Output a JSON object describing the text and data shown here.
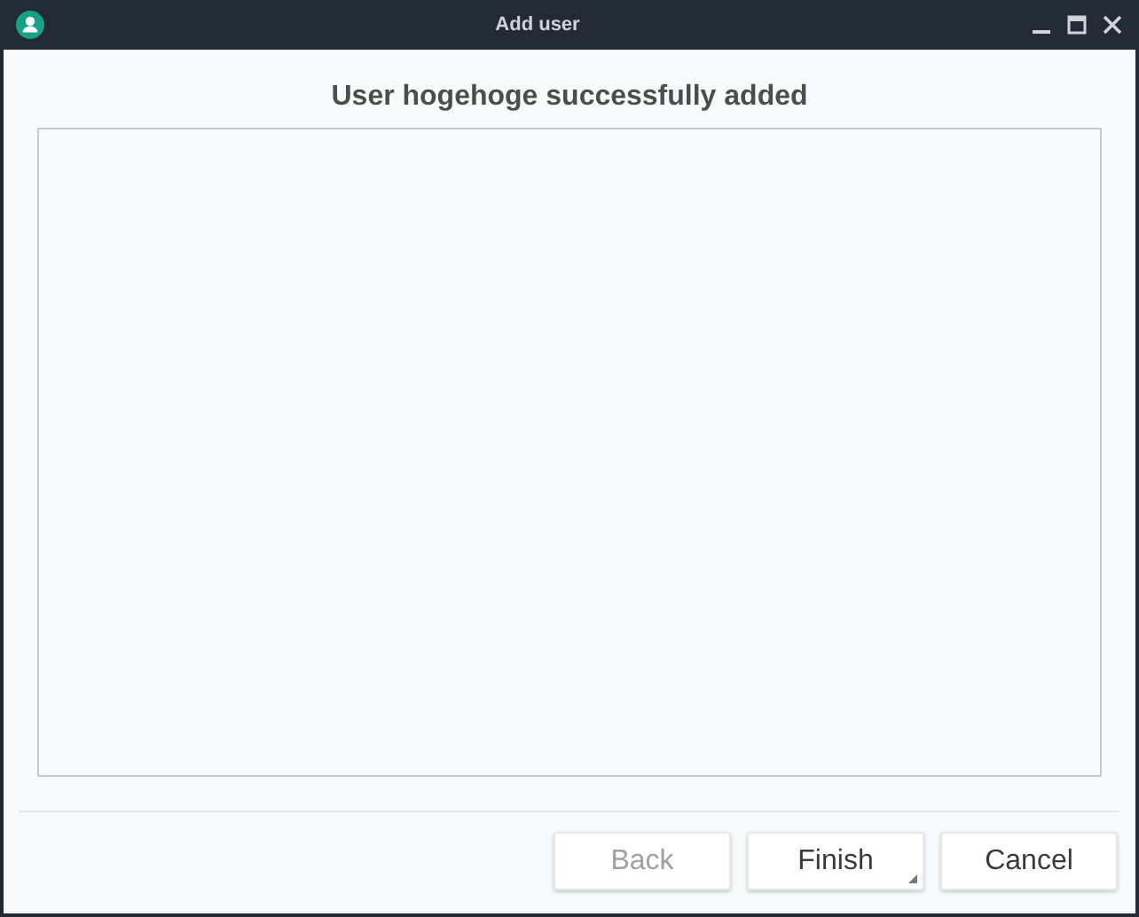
{
  "window": {
    "title": "Add user"
  },
  "heading": "User hogehoge successfully added",
  "buttons": [
    {
      "label": "Back",
      "disabled": true,
      "default": false
    },
    {
      "label": "Finish",
      "disabled": false,
      "default": true
    },
    {
      "label": "Cancel",
      "disabled": false,
      "default": false
    }
  ]
}
